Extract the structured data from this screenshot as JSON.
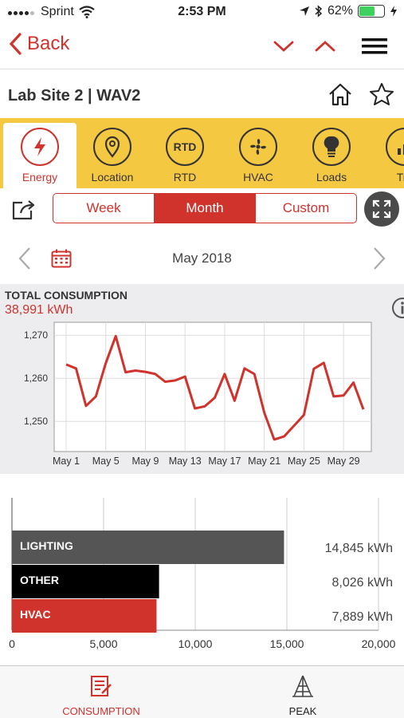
{
  "status": {
    "carrier": "Sprint",
    "time": "2:53 PM",
    "battery": "62%",
    "battery_level": 0.62
  },
  "nav": {
    "back_label": "Back"
  },
  "site": {
    "title": "Lab Site 2 | WAV2"
  },
  "tabs": [
    {
      "label": "Energy",
      "icon": "lightning-icon",
      "active": true
    },
    {
      "label": "Location",
      "icon": "location-pin-icon"
    },
    {
      "label": "RTD",
      "icon": "rtd-icon",
      "icon_text": "RTD"
    },
    {
      "label": "HVAC",
      "icon": "fan-icon"
    },
    {
      "label": "Loads",
      "icon": "bulb-icon"
    },
    {
      "label": "Tre",
      "icon": "trend-icon"
    }
  ],
  "range": {
    "options": [
      "Week",
      "Month",
      "Custom"
    ],
    "selected": "Month"
  },
  "period": {
    "label": "May 2018"
  },
  "consumption": {
    "label": "TOTAL CONSUMPTION",
    "value": "38,991 kWh"
  },
  "chart_data": [
    {
      "type": "line",
      "x_tick_labels": [
        "May 1",
        "May 5",
        "May 9",
        "May 13",
        "May 17",
        "May 21",
        "May 25",
        "May 29"
      ],
      "x": [
        1,
        2,
        3,
        4,
        5,
        6,
        7,
        8,
        9,
        10,
        11,
        12,
        13,
        14,
        15,
        16,
        17,
        18,
        19,
        20,
        21,
        22,
        23,
        24,
        25,
        26,
        27,
        28,
        29,
        30,
        31
      ],
      "series": [
        {
          "color": "#d0322c",
          "values": [
            1263.2,
            1262.3,
            1253.6,
            1255.8,
            1263.5,
            1269.8,
            1261.4,
            1261.8,
            1261.5,
            1261.0,
            1259.2,
            1259.5,
            1260.4,
            1253.0,
            1253.5,
            1255.5,
            1261.0,
            1254.8,
            1262.3,
            1261.0,
            1252.0,
            1245.8,
            1246.5,
            1249.0,
            1251.5,
            1262.2,
            1263.6,
            1255.8,
            1256.0,
            1259.0,
            1252.8
          ]
        }
      ],
      "y_ticks": [
        "1,250",
        "1,260",
        "1,270"
      ],
      "ylim": [
        1243,
        1273
      ],
      "grid": true
    },
    {
      "type": "bar",
      "orientation": "horizontal",
      "categories": [
        "LIGHTING",
        "OTHER",
        "HVAC"
      ],
      "values": [
        14845,
        8026,
        7889
      ],
      "value_labels": [
        "14,845 kWh",
        "8,026 kWh",
        "7,889 kWh"
      ],
      "colors": [
        "#555555",
        "#000000",
        "#d0322c"
      ],
      "x_ticks": [
        "0",
        "5,000",
        "10,000",
        "15,000",
        "20,000"
      ],
      "xlim": [
        0,
        20000
      ],
      "grid": true
    }
  ],
  "bottom_tabs": [
    {
      "label": "CONSUMPTION",
      "icon": "consumption-icon",
      "active": true
    },
    {
      "label": "PEAK",
      "icon": "peak-icon"
    }
  ]
}
